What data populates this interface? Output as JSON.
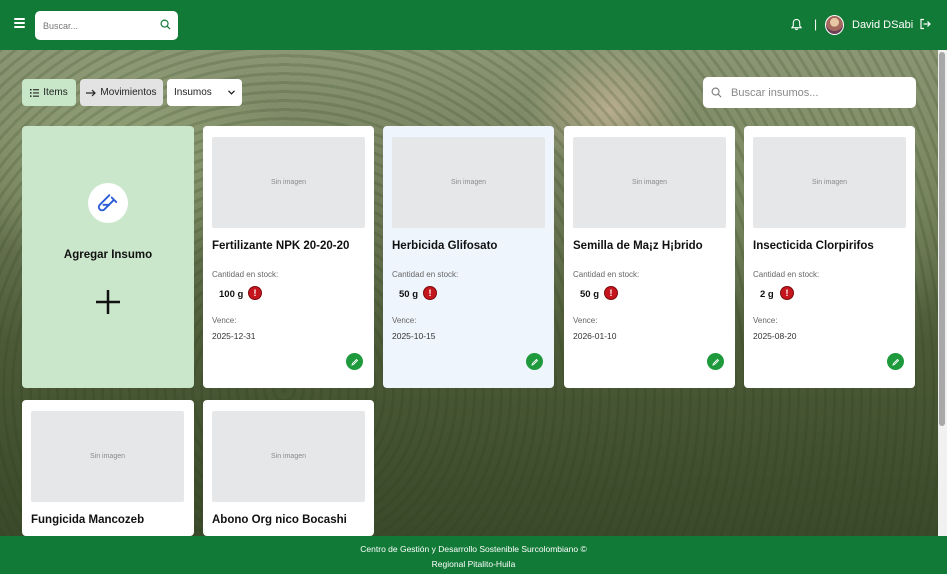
{
  "header": {
    "search_placeholder": "Buscar...",
    "user_name": "David DSabi",
    "separator": "|"
  },
  "toolbar": {
    "items_label": "Items",
    "movements_label": "Movimientos",
    "select_value": "Insumos",
    "search_placeholder": "Buscar insumos..."
  },
  "add_card": {
    "title": "Agregar Insumo"
  },
  "labels": {
    "no_image": "Sin imagen",
    "stock": "Cantidad en stock:",
    "expires": "Vence:"
  },
  "products": [
    {
      "name": "Fertilizante NPK 20-20-20",
      "qty": "100 g",
      "alert": "!",
      "expires": "2025-12-31"
    },
    {
      "name": "Herbicida Glifosato",
      "qty": "50 g",
      "alert": "!",
      "expires": "2025-10-15"
    },
    {
      "name": "Semilla de Ma¡z H¡brido",
      "qty": "50 g",
      "alert": "!",
      "expires": "2026-01-10"
    },
    {
      "name": "Insecticida Clorpirifos",
      "qty": "2 g",
      "alert": "!",
      "expires": "2025-08-20"
    },
    {
      "name": "Fungicida Mancozeb"
    },
    {
      "name": "Abono Org nico Bocashi"
    }
  ],
  "footer": {
    "line1": "Centro de Gestión y Desarrollo Sostenible Surcolombiano ©",
    "line2": "Regional Pitalito-Huila"
  },
  "colors": {
    "brand_green": "#127a37",
    "add_card_bg": "#cbe7cb",
    "alert_red": "#c4161c",
    "edit_green": "#1e9a3d"
  }
}
